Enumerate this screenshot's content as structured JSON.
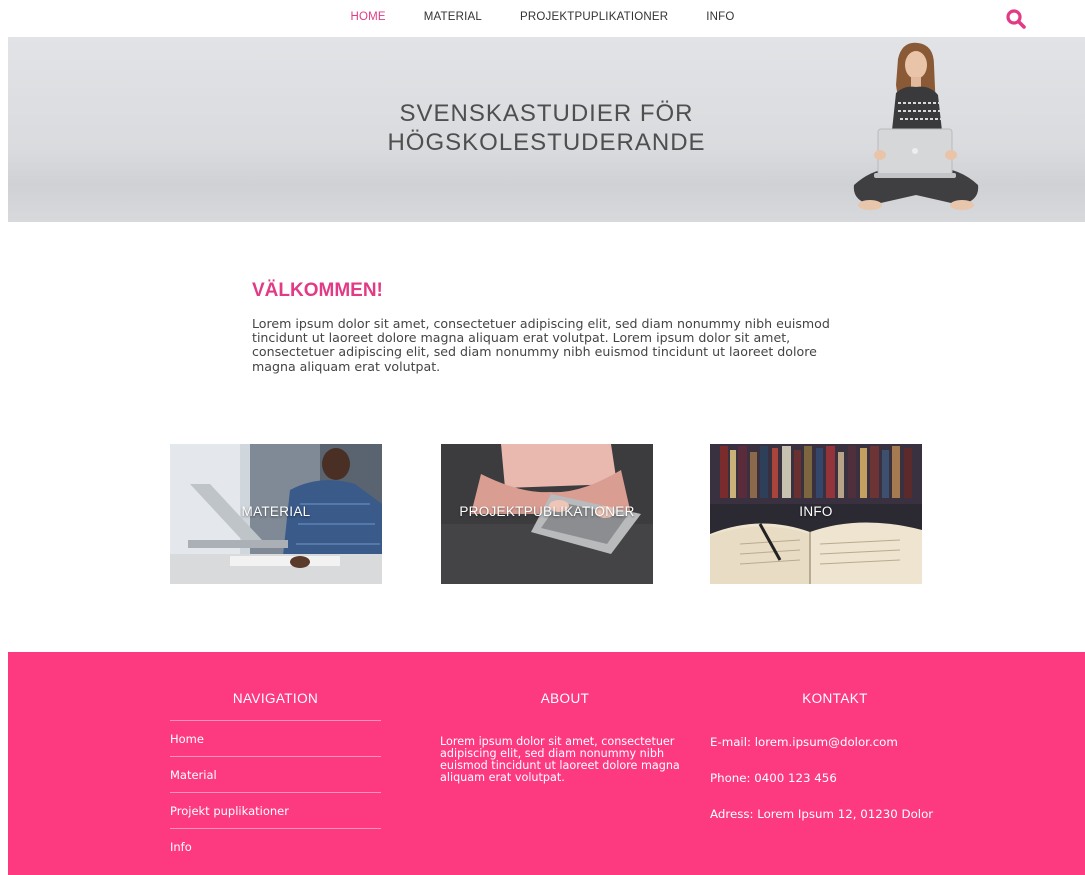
{
  "nav": {
    "items": [
      {
        "label": "HOME",
        "active": true
      },
      {
        "label": "MATERIAL",
        "active": false
      },
      {
        "label": "PROJEKTPUPLIKATIONER",
        "active": false
      },
      {
        "label": "INFO",
        "active": false
      }
    ],
    "search_icon": "search-icon"
  },
  "hero": {
    "title_line1": "SVENSKASTUDIER  FÖR",
    "title_line2": "HÖGSKOLESTUDERANDE"
  },
  "welcome": {
    "heading": "VÄLKOMMEN!",
    "body": "Lorem ipsum dolor sit amet, consectetuer adipiscing elit, sed diam nonummy nibh euismod tincidunt ut laoreet dolore magna aliquam erat volutpat. Lorem ipsum dolor sit amet, consectetuer adipiscing elit, sed diam nonummy nibh euismod tincidunt ut laoreet dolore magna aliquam erat volutpat."
  },
  "tiles": [
    {
      "label": "MATERIAL"
    },
    {
      "label": "PROJEKTPUBLIKATIONER"
    },
    {
      "label": "INFO"
    }
  ],
  "footer": {
    "navigation": {
      "heading": "NAVIGATION",
      "items": [
        "Home",
        "Material",
        "Projekt puplikationer",
        "Info"
      ]
    },
    "about": {
      "heading": "ABOUT",
      "text": "Lorem ipsum dolor sit amet, consectetuer adipiscing elit, sed diam nonummy nibh euismod tincidunt ut laoreet dolore magna aliquam erat volutpat."
    },
    "kontakt": {
      "heading": "KONTAKT",
      "email": "E-mail: lorem.ipsum@dolor.com",
      "phone": "Phone: 0400 123 456",
      "address": "Adress: Lorem Ipsum 12, 01230 Dolor"
    }
  },
  "colors": {
    "accent": "#e23b86",
    "footer_bg": "#fd3a80"
  }
}
